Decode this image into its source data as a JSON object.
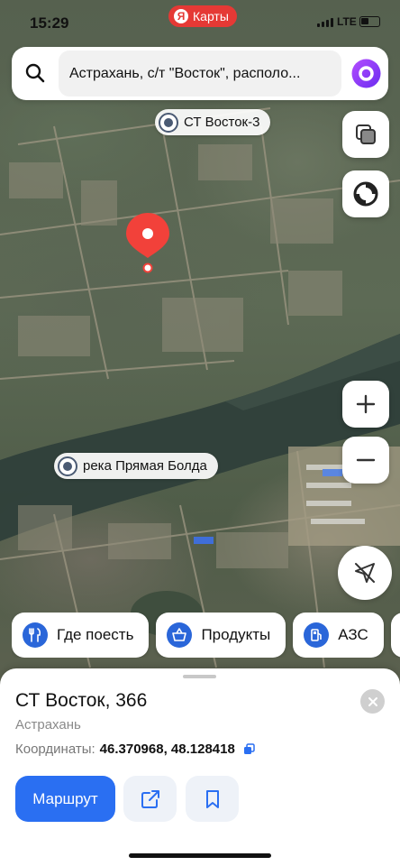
{
  "status_bar": {
    "time": "15:29",
    "brand_letter": "Я",
    "brand_label": "Карты",
    "network": "LTE"
  },
  "search": {
    "query": "Астрахань, с/т \"Восток\", располо...",
    "search_icon": "search-icon",
    "assistant_icon": "alice-icon"
  },
  "map": {
    "labels": {
      "st_vostok_3": "СТ Восток-3",
      "river": "река Прямая Болда"
    },
    "controls": {
      "layers_icon": "layers-icon",
      "traffic_icon": "traffic-icon",
      "zoom_in": "+",
      "zoom_out": "−",
      "locate_icon": "location-arrow-icon"
    },
    "pin_color": "#f2413a"
  },
  "categories": [
    {
      "label": "Где поесть",
      "icon": "fork-knife-icon"
    },
    {
      "label": "Продукты",
      "icon": "basket-icon"
    },
    {
      "label": "АЗС",
      "icon": "fuel-icon"
    }
  ],
  "place_card": {
    "title": "СТ Восток, 366",
    "city": "Астрахань",
    "coords_label": "Координаты:",
    "coords_value": "46.370968, 48.128418",
    "route_label": "Маршрут",
    "share_icon": "share-icon",
    "bookmark_icon": "bookmark-icon",
    "close_icon": "close-icon"
  },
  "colors": {
    "accent": "#2a6ff2",
    "brand": "#e53935",
    "category_icon_bg": "#2a66d9"
  }
}
